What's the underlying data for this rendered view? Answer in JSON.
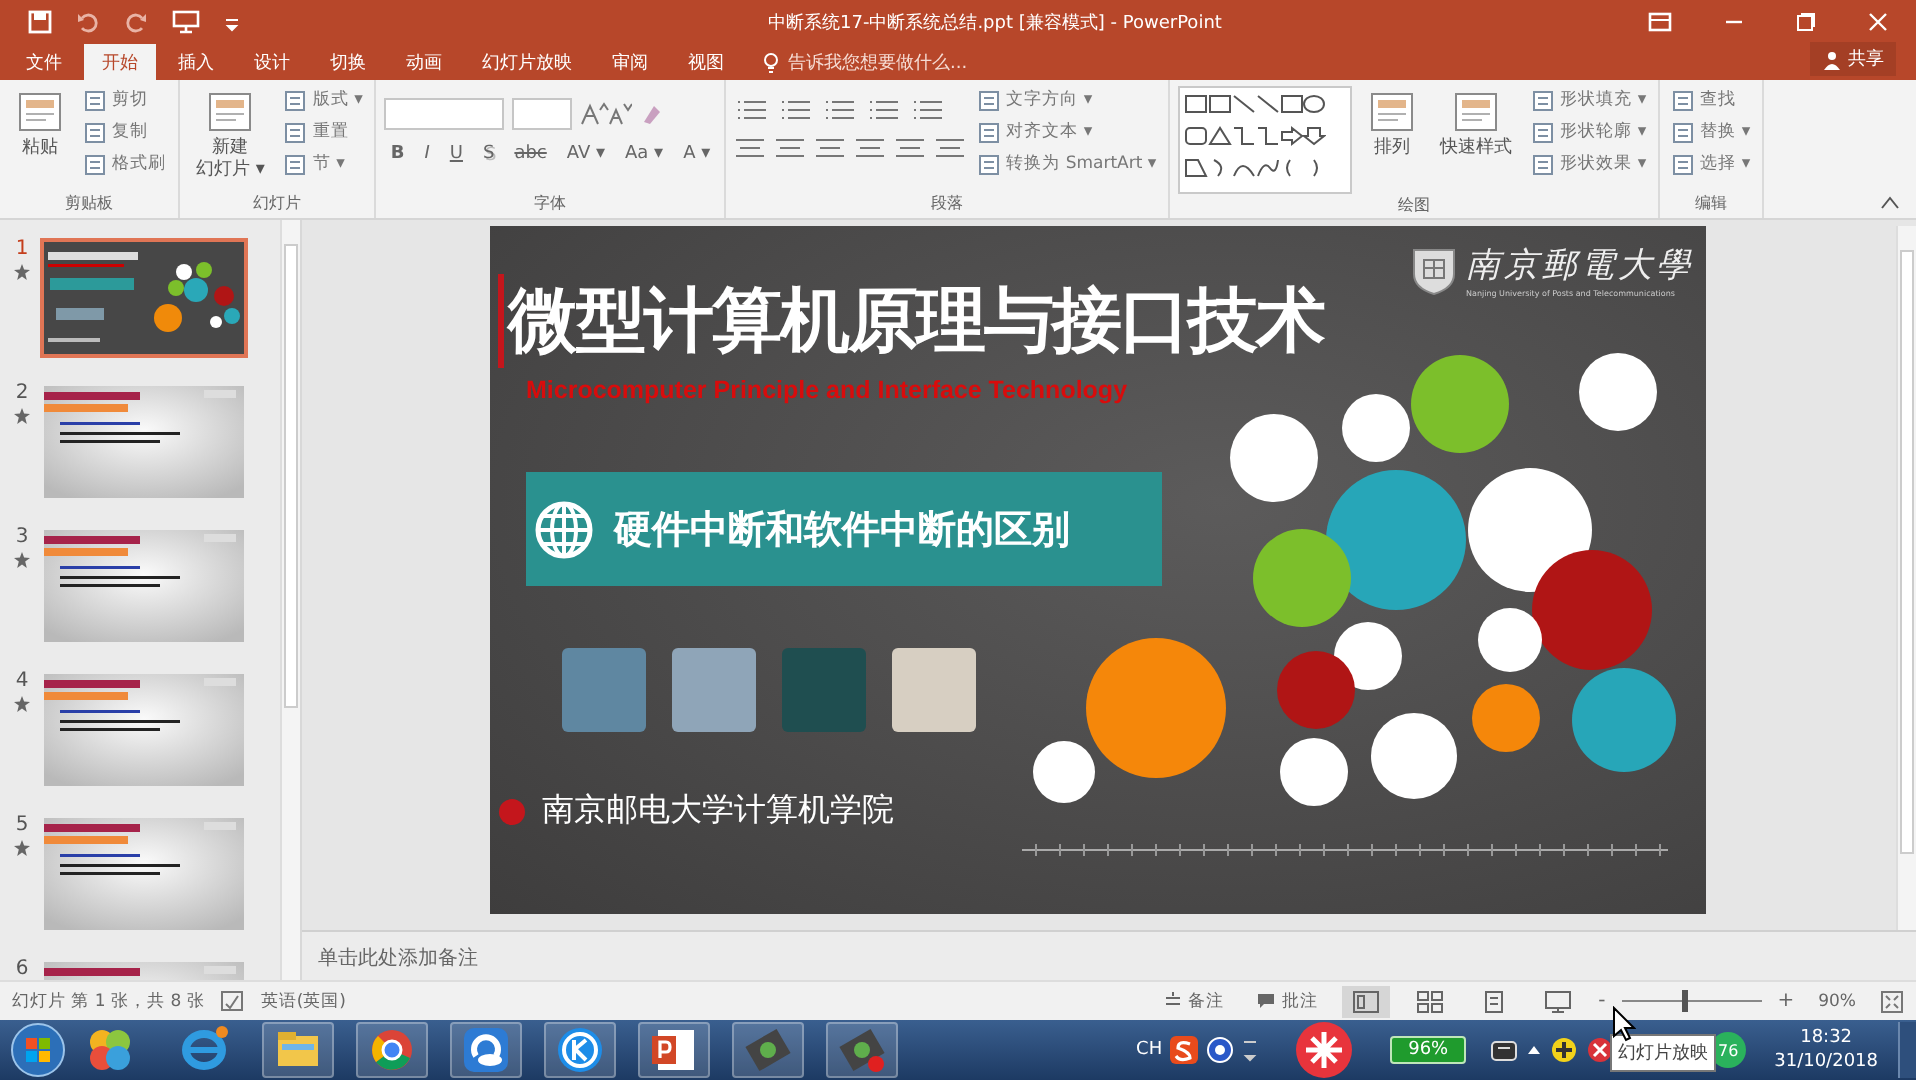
{
  "window": {
    "title": "中断系统17-中断系统总结.ppt [兼容模式] - PowerPoint"
  },
  "tabs": [
    {
      "label": "文件",
      "selected": false
    },
    {
      "label": "开始",
      "selected": true
    },
    {
      "label": "插入",
      "selected": false
    },
    {
      "label": "设计",
      "selected": false
    },
    {
      "label": "切换",
      "selected": false
    },
    {
      "label": "动画",
      "selected": false
    },
    {
      "label": "幻灯片放映",
      "selected": false
    },
    {
      "label": "审阅",
      "selected": false
    },
    {
      "label": "视图",
      "selected": false
    }
  ],
  "tell_me": {
    "placeholder": "告诉我您想要做什么..."
  },
  "share_button": {
    "label": "共享"
  },
  "ribbon_groups": [
    {
      "kind": "columns",
      "label": "剪贴板",
      "columns": [
        [
          {
            "kind": "large",
            "label": "粘贴"
          }
        ],
        [
          {
            "kind": "small",
            "label": "剪切"
          },
          {
            "kind": "small",
            "label": "复制"
          },
          {
            "kind": "small",
            "label": "格式刷"
          }
        ]
      ]
    },
    {
      "kind": "columns",
      "label": "幻灯片",
      "columns": [
        [
          {
            "kind": "large",
            "lines": [
              "新建",
              "幻灯片 ▾"
            ]
          }
        ],
        [
          {
            "kind": "small",
            "label": "版式 ▾"
          },
          {
            "kind": "small",
            "label": "重置"
          },
          {
            "kind": "small",
            "label": "节 ▾"
          }
        ]
      ]
    },
    {
      "kind": "font",
      "label": "字体",
      "buttons": [
        "B",
        "I",
        "U",
        "S",
        "abc",
        "AV ▾",
        "Aa ▾",
        "A ▾"
      ]
    },
    {
      "kind": "paragraph",
      "label": "段落",
      "columns": [
        [
          {
            "kind": "small",
            "label": "文字方向 ▾"
          },
          {
            "kind": "small",
            "label": "对齐文本 ▾"
          },
          {
            "kind": "small",
            "label": "转换为 SmartArt ▾"
          }
        ]
      ]
    },
    {
      "kind": "drawing",
      "label": "绘图",
      "columns": [
        [
          {
            "kind": "large",
            "label": "排列"
          }
        ],
        [
          {
            "kind": "large",
            "label": "快速样式"
          }
        ],
        [
          {
            "kind": "small",
            "label": "形状填充 ▾"
          },
          {
            "kind": "small",
            "label": "形状轮廓 ▾"
          },
          {
            "kind": "small",
            "label": "形状效果 ▾"
          }
        ]
      ]
    },
    {
      "kind": "columns",
      "label": "编辑",
      "columns": [
        [
          {
            "kind": "small",
            "label": "查找"
          },
          {
            "kind": "small",
            "label": "替换 ▾"
          },
          {
            "kind": "small",
            "label": "选择 ▾"
          }
        ]
      ]
    }
  ],
  "thumbnails": [
    {
      "number": "1",
      "kind": "title",
      "selected": true
    },
    {
      "number": "2",
      "kind": "content",
      "selected": false
    },
    {
      "number": "3",
      "kind": "content",
      "selected": false
    },
    {
      "number": "4",
      "kind": "content",
      "selected": false
    },
    {
      "number": "5",
      "kind": "content",
      "selected": false
    },
    {
      "number": "6",
      "kind": "content",
      "selected": false
    }
  ],
  "slide": {
    "title": "微型计算机原理与接口技术",
    "subtitle": "Microcomputer Principle and Interface Technology",
    "logo_name": "南京郵電大學",
    "logo_caption": "Nanjing University of Posts and Telecommunications",
    "banner": "硬件中断和软件中断的区别",
    "footer": "南京邮电大学计算机学院"
  },
  "notes": {
    "placeholder": "单击此处添加备注"
  },
  "status_bar": {
    "slide_position": "幻灯片 第 1 张，共 8 张",
    "language": "英语(英国)",
    "notes_button": "备注",
    "comments_button": "批注",
    "views": [
      {
        "selected": true
      },
      {
        "selected": false
      },
      {
        "selected": false
      },
      {
        "selected": false
      }
    ],
    "zoom_minus": "-",
    "zoom_plus": "+",
    "zoom": {
      "level": 0.43
    },
    "zoom_reading": "90%"
  },
  "taskbar": {
    "input_language": "CH",
    "battery": "96%",
    "badge": "76",
    "tooltip": "幻灯片放映",
    "time": "18:32",
    "date": "31/10/2018"
  }
}
